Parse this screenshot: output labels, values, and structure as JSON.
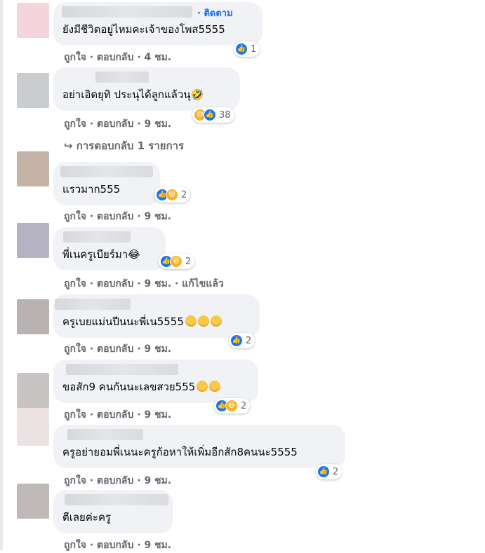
{
  "comments": [
    {
      "text": "ยังมีชีวิตอยู่ไหมคะเจ้าของโพส5555",
      "follow": "· ติดตาม",
      "reaction_count": "1",
      "meta": "ถูกใจ · ตอบกลับ · 4 ชม."
    },
    {
      "text": "อย่าเอิดยุทิ ประนุได้ลูกแล้วนุ🤣",
      "reaction_count": "38",
      "meta": "ถูกใจ · ตอบกลับ · 9 ชม.",
      "replies": "↪ การตอบกลับ 1 รายการ"
    },
    {
      "text": "แรวมาก555",
      "reaction_count": "2",
      "meta": "ถูกใจ · ตอบกลับ · 9 ชม."
    },
    {
      "text": "พี่เนครูเบียร์มา😂",
      "reaction_count": "2",
      "meta": "ถูกใจ · ตอบกลับ · 9 ชม. · แก้ไขแล้ว"
    },
    {
      "text": "ครูเบยแม่นปีนนะพี่เน5555",
      "reaction_count": "2",
      "meta": "ถูกใจ · ตอบกลับ · 9 ชม."
    },
    {
      "text": "ขอสัก9 คนกันนะเลขสวย555",
      "reaction_count": "2",
      "meta": "ถูกใจ · ตอบกลับ · 9 ชม."
    },
    {
      "text": "ครูอย่ายอมพี่เนนะครูก้อหาให้เพิ่มอีกสัก8คนนะ5555",
      "reaction_count": "2",
      "meta": "ถูกใจ · ตอบกลับ · 9 ชม."
    },
    {
      "text": "ตีเลยค่ะครู",
      "meta": "ถูกใจ · ตอบกลับ · 9 ชม."
    }
  ],
  "colors": {
    "like": "#1877f2",
    "haha": "#f7b125",
    "link": "#216fdb",
    "bubble": "#f0f2f5",
    "meta": "#65676b"
  }
}
